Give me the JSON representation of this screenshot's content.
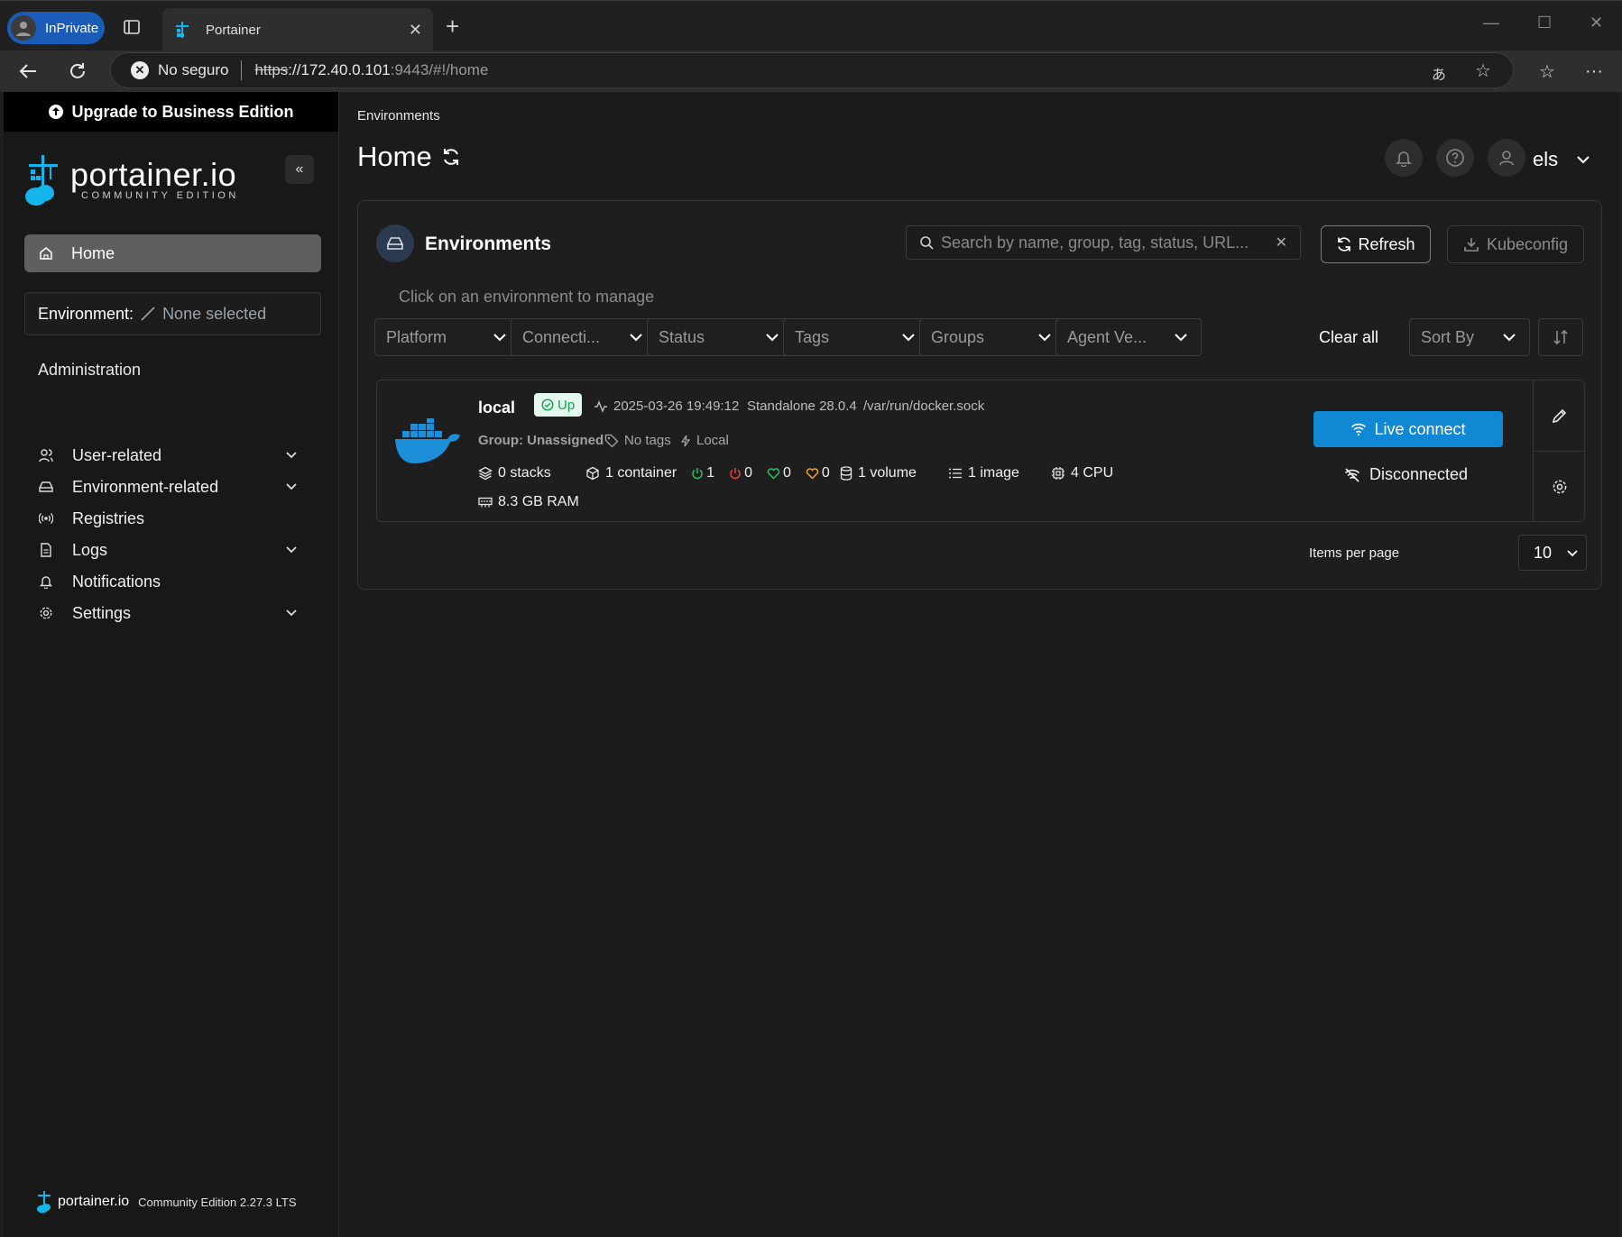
{
  "browser": {
    "inprivate_label": "InPrivate",
    "tab_title": "Portainer",
    "insecure_label": "No seguro",
    "url_protocol": "https",
    "url_host": "://172.40.0.101",
    "url_rest": ":9443/#!/home"
  },
  "sidebar": {
    "upgrade_label": "Upgrade to Business Edition",
    "logo_main": "portainer.io",
    "logo_sub": "COMMUNITY EDITION",
    "home_label": "Home",
    "environment_key": "Environment:",
    "environment_value": "None selected",
    "admin_heading": "Administration",
    "items": [
      {
        "label": "User-related",
        "icon": "users-icon",
        "expandable": true
      },
      {
        "label": "Environment-related",
        "icon": "drive-icon",
        "expandable": true
      },
      {
        "label": "Registries",
        "icon": "radio-icon",
        "expandable": false
      },
      {
        "label": "Logs",
        "icon": "file-icon",
        "expandable": true
      },
      {
        "label": "Notifications",
        "icon": "bell-icon",
        "expandable": false
      },
      {
        "label": "Settings",
        "icon": "gear-icon",
        "expandable": true
      }
    ],
    "footer_brand": "portainer.io",
    "footer_version": "Community Edition 2.27.3 LTS"
  },
  "header": {
    "breadcrumb": "Environments",
    "title": "Home",
    "username": "els"
  },
  "panel": {
    "title": "Environments",
    "search_placeholder": "Search by name, group, tag, status, URL...",
    "refresh_label": "Refresh",
    "kubeconfig_label": "Kubeconfig",
    "hint": "Click on an environment to manage",
    "filters": [
      "Platform",
      "Connecti...",
      "Status",
      "Tags",
      "Groups",
      "Agent Ve..."
    ],
    "clear_all": "Clear all",
    "sort_by": "Sort By",
    "items_per_page_label": "Items per page",
    "items_per_page_value": "10"
  },
  "environment": {
    "name": "local",
    "status": "Up",
    "timestamp": "2025-03-26 19:49:12",
    "type": "Standalone 28.0.4",
    "socket": "/var/run/docker.sock",
    "group": "Group: Unassigned",
    "tags": "No tags",
    "location": "Local",
    "stacks": "0 stacks",
    "containers": "1 container",
    "running": "1",
    "stopped": "0",
    "healthy": "0",
    "unhealthy": "0",
    "volumes": "1 volume",
    "images": "1 image",
    "cpu": "4 CPU",
    "ram": "8.3 GB RAM",
    "live_connect": "Live connect",
    "connection": "Disconnected"
  },
  "colors": {
    "accent": "#1088d4",
    "up_bg": "#e4f8ee",
    "up_text": "#13a150",
    "running": "#2bbf6a",
    "stopped": "#e04545",
    "healthy": "#2bbf6a",
    "unhealthy": "#e8a33a"
  }
}
